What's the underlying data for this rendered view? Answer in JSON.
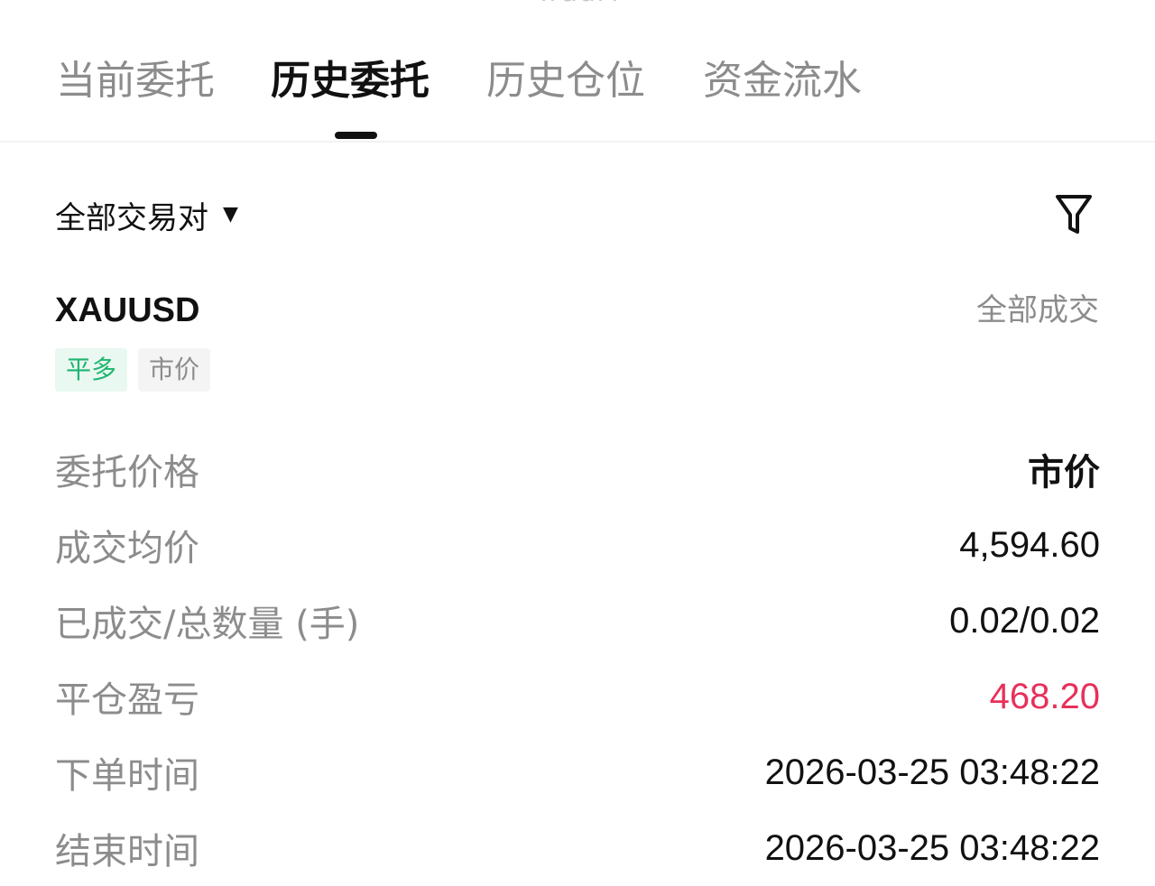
{
  "header": {
    "cut_title": "TradFi"
  },
  "tabs": [
    {
      "label": "当前委托",
      "active": false
    },
    {
      "label": "历史委托",
      "active": true
    },
    {
      "label": "历史仓位",
      "active": false
    },
    {
      "label": "资金流水",
      "active": false
    }
  ],
  "filters": {
    "pair_label": "全部交易对",
    "filter_icon": "filter-icon"
  },
  "order": {
    "symbol": "XAUUSD",
    "status": "全部成交",
    "side_tag": "平多",
    "type_tag": "市价",
    "rows": [
      {
        "label": "委托价格",
        "value": "市价"
      },
      {
        "label": "成交均价",
        "value": "4,594.60"
      },
      {
        "label": "已成交/总数量 (手)",
        "value": "0.02/0.02"
      },
      {
        "label": "平仓盈亏",
        "value": "468.20"
      },
      {
        "label": "下单时间",
        "value": "2026-03-25 03:48:22"
      },
      {
        "label": "结束时间",
        "value": "2026-03-25 03:48:22"
      }
    ]
  },
  "colors": {
    "profit": "#e8305a",
    "tag_side_bg": "#e9f8f0",
    "tag_side_text": "#1fb570",
    "muted_text": "#8c8c8c",
    "primary_text": "#111111"
  }
}
